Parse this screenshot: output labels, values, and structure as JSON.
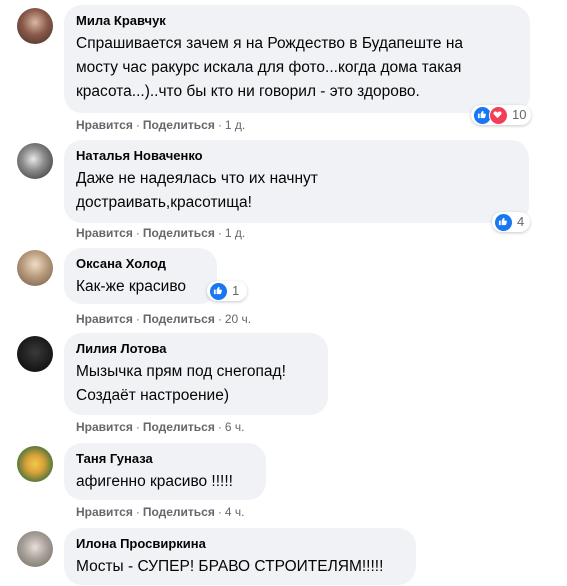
{
  "actions": {
    "like_label": "Нравится",
    "reply_label": "Поделиться",
    "separator": "·"
  },
  "comments": [
    {
      "author": "Мила Кравчук",
      "lines": [
        "Спрашивается зачем я на Рождество в Будапеште на",
        "мосту час ракурс искала для фото...когда дома такая",
        "красота...)..что бы кто ни говорил - это здорово."
      ],
      "time": "1 д.",
      "reaction_icons": [
        "like-icon",
        "love-icon"
      ],
      "reaction_count": "10"
    },
    {
      "author": "Наталья Новаченко",
      "lines": [
        "Даже не надеялась что их начнут",
        "достраивать,красотища!"
      ],
      "time": "1 д.",
      "reaction_icons": [
        "like-icon"
      ],
      "reaction_count": "4"
    },
    {
      "author": "Оксана Холод",
      "lines": [
        "Как-же красиво"
      ],
      "time": "20 ч.",
      "reaction_icons": [
        "like-icon"
      ],
      "reaction_count": "1"
    },
    {
      "author": "Лилия Лотова",
      "lines": [
        "Мызычка прям под снегопад!",
        "Создаёт настроение)"
      ],
      "time": "6 ч."
    },
    {
      "author": "Таня Гуназа",
      "lines": [
        "афигенно красиво !!!!!"
      ],
      "time": "4 ч."
    },
    {
      "author": "Илона Просвиркина",
      "lines": [
        "Мосты - СУПЕР! БРАВО СТРОИТЕЛЯМ!!!!!"
      ]
    }
  ],
  "colors": {
    "bubble": "#f0f2f5",
    "meta_text": "#65676b",
    "like": "#1877f2",
    "love": "#f33e58"
  }
}
